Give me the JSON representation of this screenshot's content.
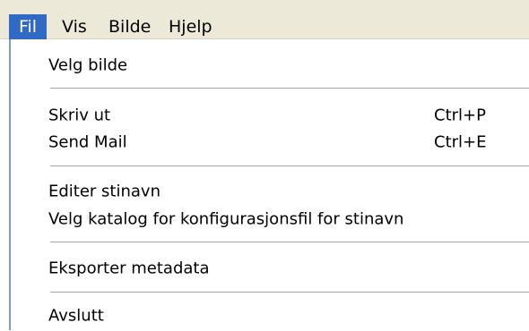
{
  "menubar": {
    "items": [
      {
        "label": "Fil",
        "active": true
      },
      {
        "label": "Vis",
        "active": false
      },
      {
        "label": "Bilde",
        "active": false
      },
      {
        "label": "Hjelp",
        "active": false
      }
    ]
  },
  "menu": {
    "items": [
      {
        "label": "Velg bilde",
        "shortcut": ""
      },
      {
        "label": "Skriv ut",
        "shortcut": "Ctrl+P"
      },
      {
        "label": "Send Mail",
        "shortcut": "Ctrl+E"
      },
      {
        "label": "Editer stinavn",
        "shortcut": ""
      },
      {
        "label": "Velg katalog for konfigurasjonsfil for stinavn",
        "shortcut": ""
      },
      {
        "label": "Eksporter metadata",
        "shortcut": ""
      },
      {
        "label": "Avslutt",
        "shortcut": ""
      }
    ]
  },
  "colors": {
    "highlight": "#316ac5",
    "menubar_bg": "#ece9d8",
    "menu_bg": "#ffffff",
    "separator": "#a7a6aa"
  }
}
